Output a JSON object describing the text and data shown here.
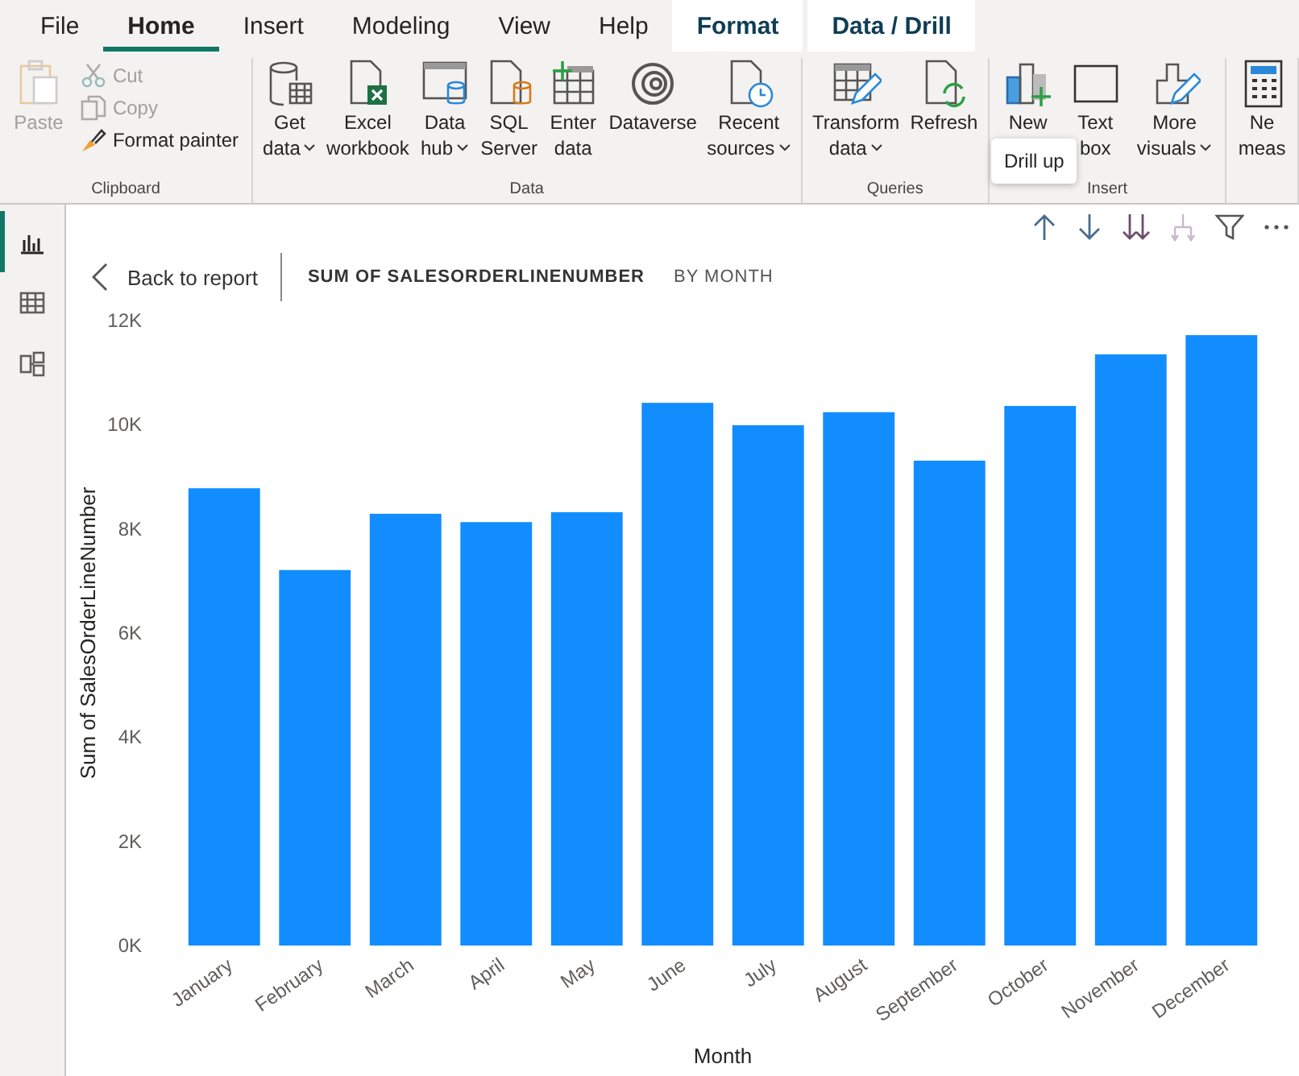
{
  "menu_tabs": [
    {
      "label": "File",
      "selected": false,
      "kind": "standard"
    },
    {
      "label": "Home",
      "selected": true,
      "kind": "standard"
    },
    {
      "label": "Insert",
      "selected": false,
      "kind": "standard"
    },
    {
      "label": "Modeling",
      "selected": false,
      "kind": "standard"
    },
    {
      "label": "View",
      "selected": false,
      "kind": "standard"
    },
    {
      "label": "Help",
      "selected": false,
      "kind": "standard"
    },
    {
      "label": "Format",
      "selected": false,
      "kind": "contextual"
    },
    {
      "label": "Data / Drill",
      "selected": false,
      "kind": "contextual"
    }
  ],
  "ribbon_groups": [
    {
      "label": "Clipboard",
      "kind": "clipboard",
      "buttons": [
        {
          "lines": [
            "Paste"
          ],
          "disabled": true
        },
        {
          "lines": [
            "Cut"
          ],
          "disabled": true
        },
        {
          "lines": [
            "Copy"
          ],
          "disabled": true
        },
        {
          "lines": [
            "Format painter"
          ],
          "disabled": false
        }
      ]
    },
    {
      "label": "Data",
      "kind": "large",
      "buttons": [
        {
          "lines": [
            "Get",
            "data"
          ],
          "disabled": false,
          "dropdown": true
        },
        {
          "lines": [
            "Excel",
            "workbook"
          ],
          "disabled": false,
          "dropdown": false
        },
        {
          "lines": [
            "Data",
            "hub"
          ],
          "disabled": false,
          "dropdown": true
        },
        {
          "lines": [
            "SQL",
            "Server"
          ],
          "disabled": false,
          "dropdown": false
        },
        {
          "lines": [
            "Enter",
            "data"
          ],
          "disabled": false,
          "dropdown": false
        },
        {
          "lines": [
            "Dataverse"
          ],
          "disabled": false,
          "dropdown": false
        },
        {
          "lines": [
            "Recent",
            "sources"
          ],
          "disabled": false,
          "dropdown": true
        }
      ]
    },
    {
      "label": "Queries",
      "kind": "large",
      "buttons": [
        {
          "lines": [
            "Transform",
            "data"
          ],
          "disabled": false,
          "dropdown": true
        },
        {
          "lines": [
            "Refresh"
          ],
          "disabled": false,
          "dropdown": false
        }
      ]
    },
    {
      "label": "Insert",
      "kind": "large",
      "buttons": [
        {
          "lines": [
            "New"
          ],
          "disabled": false,
          "dropdown": false
        },
        {
          "lines": [
            "Text",
            "box"
          ],
          "disabled": false,
          "dropdown": false
        },
        {
          "lines": [
            "More",
            "visuals"
          ],
          "disabled": false,
          "dropdown": true
        }
      ]
    },
    {
      "kind": "large",
      "buttons": [
        {
          "lines": [
            "Ne",
            "meas"
          ],
          "disabled": false,
          "dropdown": false
        }
      ]
    }
  ],
  "tooltip": "Drill up",
  "views": [
    {
      "selected": true
    },
    {
      "selected": false
    },
    {
      "selected": false
    }
  ],
  "drill_tools": [
    {
      "disabled": false
    },
    {
      "disabled": false
    },
    {
      "disabled": false
    },
    {
      "disabled": true
    },
    {
      "disabled": false
    },
    {
      "disabled": false
    }
  ],
  "visual_header": {
    "back_link": "Back to report",
    "title": "SUM OF SALESORDERLINENUMBER",
    "subtitle": "BY MONTH"
  },
  "chart_data": {
    "type": "bar",
    "xlabel": "Month",
    "ylabel": "Sum of SalesOrderLineNumber",
    "categories": [
      "January",
      "February",
      "March",
      "April",
      "May",
      "June",
      "July",
      "August",
      "September",
      "October",
      "November",
      "December"
    ],
    "values": [
      8780,
      7210,
      8290,
      8130,
      8320,
      10420,
      9990,
      10240,
      9310,
      10360,
      11350,
      11720
    ],
    "ylim": [
      0,
      12000
    ],
    "yticks": [
      {
        "value": 0,
        "label": "0K"
      },
      {
        "value": 2000,
        "label": "2K"
      },
      {
        "value": 4000,
        "label": "4K"
      },
      {
        "value": 6000,
        "label": "6K"
      },
      {
        "value": 8000,
        "label": "8K"
      },
      {
        "value": 10000,
        "label": "10K"
      },
      {
        "value": 12000,
        "label": "12K"
      }
    ]
  }
}
